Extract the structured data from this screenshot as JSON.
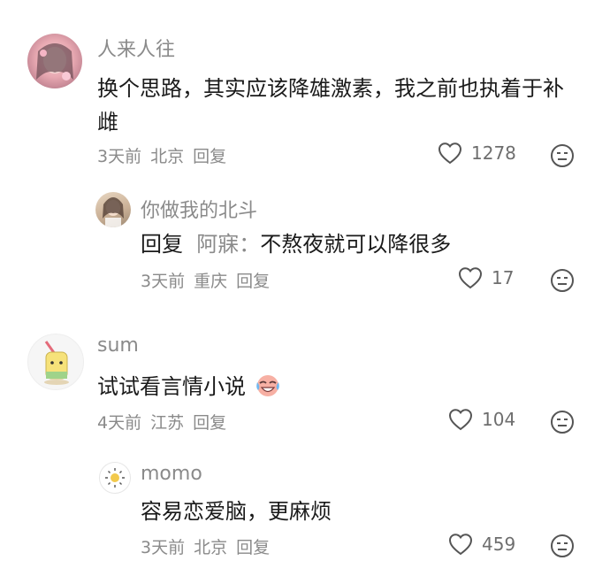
{
  "comments": [
    {
      "user": "人来人往",
      "text": "换个思路，其实应该降雄激素，我之前也执着于补雌",
      "time": "3天前",
      "location": "北京",
      "reply_label": "回复",
      "likes": "1278"
    },
    {
      "user": "你做我的北斗",
      "reply_prefix": "回复",
      "reply_to": "阿寐：",
      "text": "不熬夜就可以降很多",
      "time": "3天前",
      "location": "重庆",
      "reply_label": "回复",
      "likes": "17"
    },
    {
      "user": "sum",
      "text": "试试看言情小说",
      "emoji": "crying-laughing-face-icon",
      "time": "4天前",
      "location": "江苏",
      "reply_label": "回复",
      "likes": "104"
    },
    {
      "user": "momo",
      "text": "容易恋爱脑，更麻烦",
      "time": "3天前",
      "location": "北京",
      "reply_label": "回复",
      "likes": "459"
    }
  ],
  "icons": {
    "like": "heart-outline-icon",
    "dislike": "meh-face-icon"
  },
  "colors": {
    "text": "#1a1a1a",
    "secondary": "#8a8a8a"
  }
}
